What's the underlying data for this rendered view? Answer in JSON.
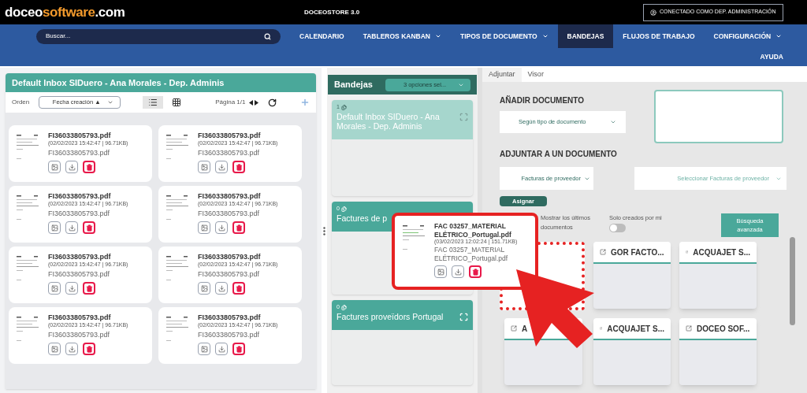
{
  "header": {
    "logo_a": "doceo",
    "logo_b": "software",
    "logo_c": ".com",
    "app_title": "DOCEOSTORE 3.0",
    "user": "CONECTADO COMO DEP. ADMINISTRACIÓN"
  },
  "search": {
    "placeholder": "Buscar..."
  },
  "nav": [
    {
      "label": "CALENDARIO",
      "dropdown": false,
      "selected": false
    },
    {
      "label": "TABLEROS KANBAN",
      "dropdown": true,
      "selected": false
    },
    {
      "label": "TIPOS DE DOCUMENTO",
      "dropdown": true,
      "selected": false
    },
    {
      "label": "BANDEJAS",
      "dropdown": false,
      "selected": true
    },
    {
      "label": "FLUJOS DE TRABAJO",
      "dropdown": false,
      "selected": false
    },
    {
      "label": "CONFIGURACIÓN",
      "dropdown": true,
      "selected": false
    },
    {
      "label": "AYUDA",
      "dropdown": false,
      "selected": false
    }
  ],
  "inbox": {
    "title": "Default Inbox SIDuero - Ana Morales - Dep. Adminis",
    "order_label": "Orden",
    "order_value": "Fecha creación ▲",
    "views": [
      {
        "kind": "list",
        "selected": true
      },
      {
        "kind": "grid",
        "selected": false
      }
    ],
    "page": "Página 1/1",
    "files": [
      {
        "name": "FI36033805793.pdf",
        "meta": "(02/02/2023 15:42:47 | 96.71KB)",
        "filename": "FI36033805793.pdf"
      },
      {
        "name": "FI36033805793.pdf",
        "meta": "(02/02/2023 15:42:47 | 96.71KB)",
        "filename": "FI36033805793.pdf"
      },
      {
        "name": "FI36033805793.pdf",
        "meta": "(02/02/2023 15:42:47 | 96.71KB)",
        "filename": "FI36033805793.pdf"
      },
      {
        "name": "FI36033805793.pdf",
        "meta": "(02/02/2023 15:42:47 | 96.71KB)",
        "filename": "FI36033805793.pdf"
      },
      {
        "name": "FI36033805793.pdf",
        "meta": "(02/02/2023 15:42:47 | 96.71KB)",
        "filename": "FI36033805793.pdf"
      },
      {
        "name": "FI36033805793.pdf",
        "meta": "(02/02/2023 15:42:47 | 96.71KB)",
        "filename": "FI36033805793.pdf"
      },
      {
        "name": "FI36033805793.pdf",
        "meta": "(02/02/2023 15:42:47 | 96.71KB)",
        "filename": "FI36033805793.pdf"
      },
      {
        "name": "FI36033805793.pdf",
        "meta": "(02/02/2023 15:42:47 | 96.71KB)",
        "filename": "FI36033805793.pdf"
      }
    ]
  },
  "trays": {
    "title": "Bandejas",
    "filter": "3 opciones sel...",
    "lanes": [
      {
        "count": "1",
        "title": "Default Inbox SIDuero - Ana Morales - Dep. Adminis",
        "selected": true,
        "expand_icon": true
      },
      {
        "count": "0",
        "title": "Factures de p",
        "selected": false
      },
      {
        "count": "0",
        "title": "Factures proveïdors Portugal",
        "selected": false,
        "expand_icon": true
      }
    ]
  },
  "attach": {
    "tabs": [
      {
        "label": "Adjuntar",
        "selected": true
      },
      {
        "label": "Visor",
        "selected": false
      }
    ],
    "add_heading": "AÑADIR DOCUMENTO",
    "add_select": "Según tipo de documento",
    "attach_heading": "ADJUNTAR A UN DOCUMENTO",
    "type_select": "Facturas de proveedor",
    "doc_select": "Seleccionar Facturas de proveedor",
    "assign_button": "Asignar",
    "recent_label": "Mostrar los últimos documentos",
    "only_mine_label": "Solo creados por mi",
    "only_mine_on": false,
    "advanced_search": "Búsqueda avanzada",
    "docs": [
      {
        "kind": "drop_slot"
      },
      {
        "kind": "doc",
        "title": "GOR FACTO..."
      },
      {
        "kind": "doc",
        "title": "ACQUAJET S..."
      },
      {
        "kind": "doc",
        "title": "A"
      },
      {
        "kind": "doc",
        "title": "ACQUAJET S..."
      },
      {
        "kind": "doc",
        "title": "DOCEO SOF..."
      }
    ]
  },
  "dragged_file": {
    "name": "FAC 03257_MATERIAL ELÉTRICO_Portugal.pdf",
    "meta": "(03/02/2023 12:02:24 | 151.71KB)",
    "filename": "FAC 03257_MATERIAL ELÉTRICO_Portugal.pdf"
  }
}
